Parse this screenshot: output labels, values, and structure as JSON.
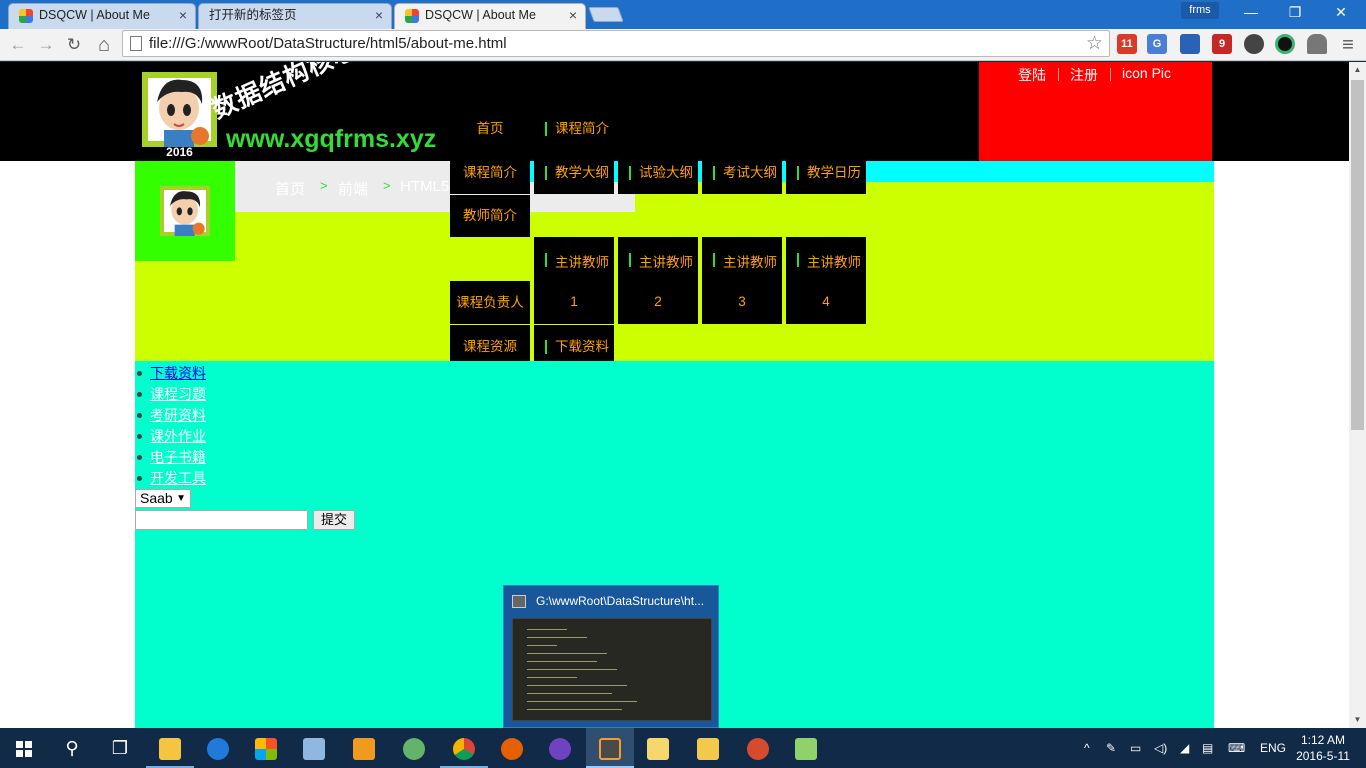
{
  "browser": {
    "tabs": [
      {
        "title": "DSQCW | About Me",
        "active": false
      },
      {
        "title": "打开新的标签页",
        "active": false
      },
      {
        "title": "DSQCW | About Me",
        "active": true
      }
    ],
    "user_badge": "frms",
    "window_controls": {
      "minimize": "—",
      "maximize": "❐",
      "close": "✕"
    },
    "url": "file:///G:/wwwRoot/DataStructure/html5/about-me.html",
    "nav_icons": {
      "back": "←",
      "forward": "→",
      "reload": "↻",
      "home": "⌂"
    },
    "star_icon": "☆",
    "menu_icon": "≡",
    "extension_badges": {
      "ext1": "11",
      "ext3": "9"
    }
  },
  "site": {
    "year": "2016",
    "title": "数据结构核心课程",
    "url_text": "www.xgqfrms.xyz",
    "login_panel": {
      "login": "登陆",
      "register": "注册",
      "icon_pic": "icon Pic"
    },
    "nav": {
      "home": "首页",
      "course_intro": "课程简介",
      "col1": [
        "课程简介",
        "教师简介",
        "课程负责人",
        "课程资源"
      ],
      "row1": [
        "教学大纲",
        "试验大纲",
        "考试大纲",
        "教学日历"
      ],
      "teachers_label": "主讲教师",
      "teacher_numbers": [
        "1",
        "2",
        "3",
        "4"
      ],
      "download": "下载资料"
    },
    "breadcrumb": {
      "home": "首页",
      "sep": ">",
      "frontend": "前端",
      "html": "HTML5"
    },
    "side_links": [
      "下载资料",
      "课程习题",
      "考研资料",
      "课外作业",
      "电子书籍",
      "开发工具"
    ],
    "select_value": "Saab",
    "submit_label": "提交"
  },
  "taskbar": {
    "preview_title": "G:\\wwwRoot\\DataStructure\\ht...",
    "language": "ENG",
    "time": "1:12 AM",
    "date": "2016-5-11"
  },
  "colors": {
    "header_bg": "#000000",
    "login_panel": "#ff0000",
    "lime": "#ccff00",
    "aqua": "#00ffcc",
    "cyan": "#00ffff",
    "green": "#33ff00",
    "menu_text": "#ffa100",
    "url_green": "#33dd33"
  }
}
